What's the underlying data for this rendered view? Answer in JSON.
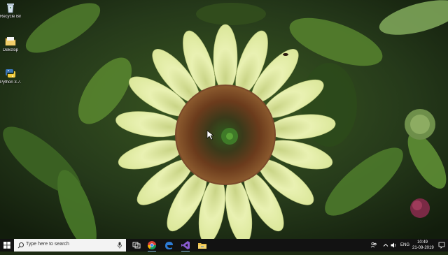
{
  "desktop": {
    "icons": [
      {
        "label": "Recycle Bin",
        "icon": "recycle-bin-icon"
      },
      {
        "label": "Dekstop",
        "icon": "folder-icon"
      },
      {
        "label": "Python 3.7...",
        "icon": "python-icon"
      }
    ]
  },
  "taskbar": {
    "search_placeholder": "Type here to search",
    "pinned_apps": [
      "task-view-icon",
      "chrome-icon",
      "edge-icon",
      "visual-studio-icon",
      "file-explorer-icon"
    ],
    "tray": {
      "language": "ENG",
      "time": "10:49",
      "date": "21-09-2019"
    }
  },
  "colors": {
    "taskbar_bg": "#121212",
    "search_bg": "#f3f3f3",
    "petal": "#e6efae",
    "flower_center": "#5a3a1e"
  }
}
